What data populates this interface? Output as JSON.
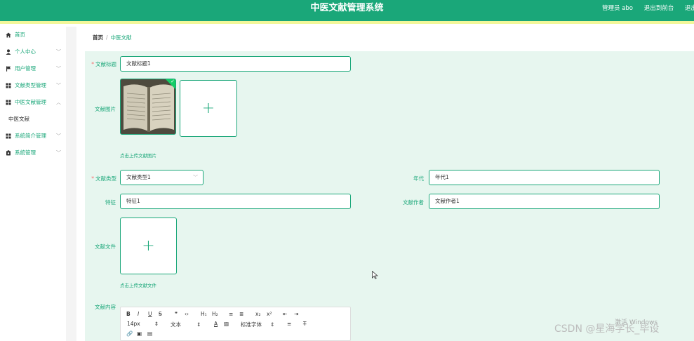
{
  "header": {
    "title": "中医文献管理系统",
    "admin": "管理员 abo",
    "back_to_front": "退出到前台",
    "logout": "退出"
  },
  "sidebar": {
    "items": [
      {
        "label": "首页"
      },
      {
        "label": "个人中心"
      },
      {
        "label": "用户管理"
      },
      {
        "label": "文献类型管理"
      },
      {
        "label": "中医文献管理"
      },
      {
        "label": "中医文献"
      },
      {
        "label": "系统简介管理"
      },
      {
        "label": "系统管理"
      }
    ]
  },
  "breadcrumb": {
    "home": "首页",
    "separator": "/",
    "current": "中医文献"
  },
  "form": {
    "title_label": "文献标题",
    "title_value": "文献标题1",
    "image_label": "文献图片",
    "image_hint": "点击上传文献图片",
    "type_label": "文献类型",
    "type_value": "文献类型1",
    "year_label": "年代",
    "year_value": "年代1",
    "feature_label": "特征",
    "feature_value": "特征1",
    "author_label": "文献作者",
    "author_value": "文献作者1",
    "file_label": "文献文件",
    "file_hint": "点击上传文献文件",
    "content_label": "文献内容",
    "required_mark": "*",
    "upload_plus": "+"
  },
  "editor": {
    "row1": [
      "B",
      "I",
      "U",
      "S",
      "❞",
      "‹›",
      "H₁",
      "H₂",
      "≡",
      "≣",
      "x₂",
      "x²",
      "⇤",
      "⇥"
    ],
    "font_size": "14px",
    "text_style": "文本",
    "font_color": "A",
    "font_family": "标准字体",
    "row3": [
      "🔗",
      "▣",
      "▤"
    ]
  },
  "watermarks": {
    "windows": "激活 Windows",
    "csdn": "CSDN @星海学长_毕设"
  },
  "colors": {
    "brand": "#1aa779",
    "stripe": "#f2f79a",
    "form_bg": "#e7f6ef",
    "required": "#f56c6c"
  }
}
